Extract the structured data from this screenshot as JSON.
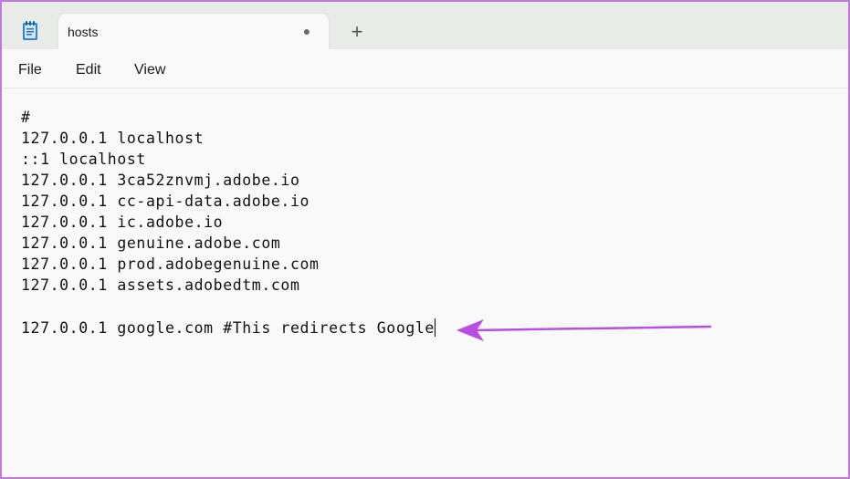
{
  "tab": {
    "title": "hosts",
    "modified_indicator": "●",
    "new_tab_symbol": "+"
  },
  "menu": {
    "items": [
      "File",
      "Edit",
      "View"
    ]
  },
  "editor": {
    "lines": [
      "#",
      "127.0.0.1 localhost",
      "::1 localhost",
      "127.0.0.1 3ca52znvmj.adobe.io",
      "127.0.0.1 cc-api-data.adobe.io",
      "127.0.0.1 ic.adobe.io",
      "127.0.0.1 genuine.adobe.com",
      "127.0.0.1 prod.adobegenuine.com",
      "127.0.0.1 assets.adobedtm.com",
      "",
      "127.0.0.1 google.com #This redirects Google"
    ]
  },
  "colors": {
    "frame_border": "#c07ad8",
    "annotation_arrow": "#b94ee0",
    "titlebar": "#e8ebe8",
    "editor_bg": "#f9f9f9"
  },
  "icons": {
    "app": "notepad-icon",
    "annotation": "arrow-left-icon"
  }
}
